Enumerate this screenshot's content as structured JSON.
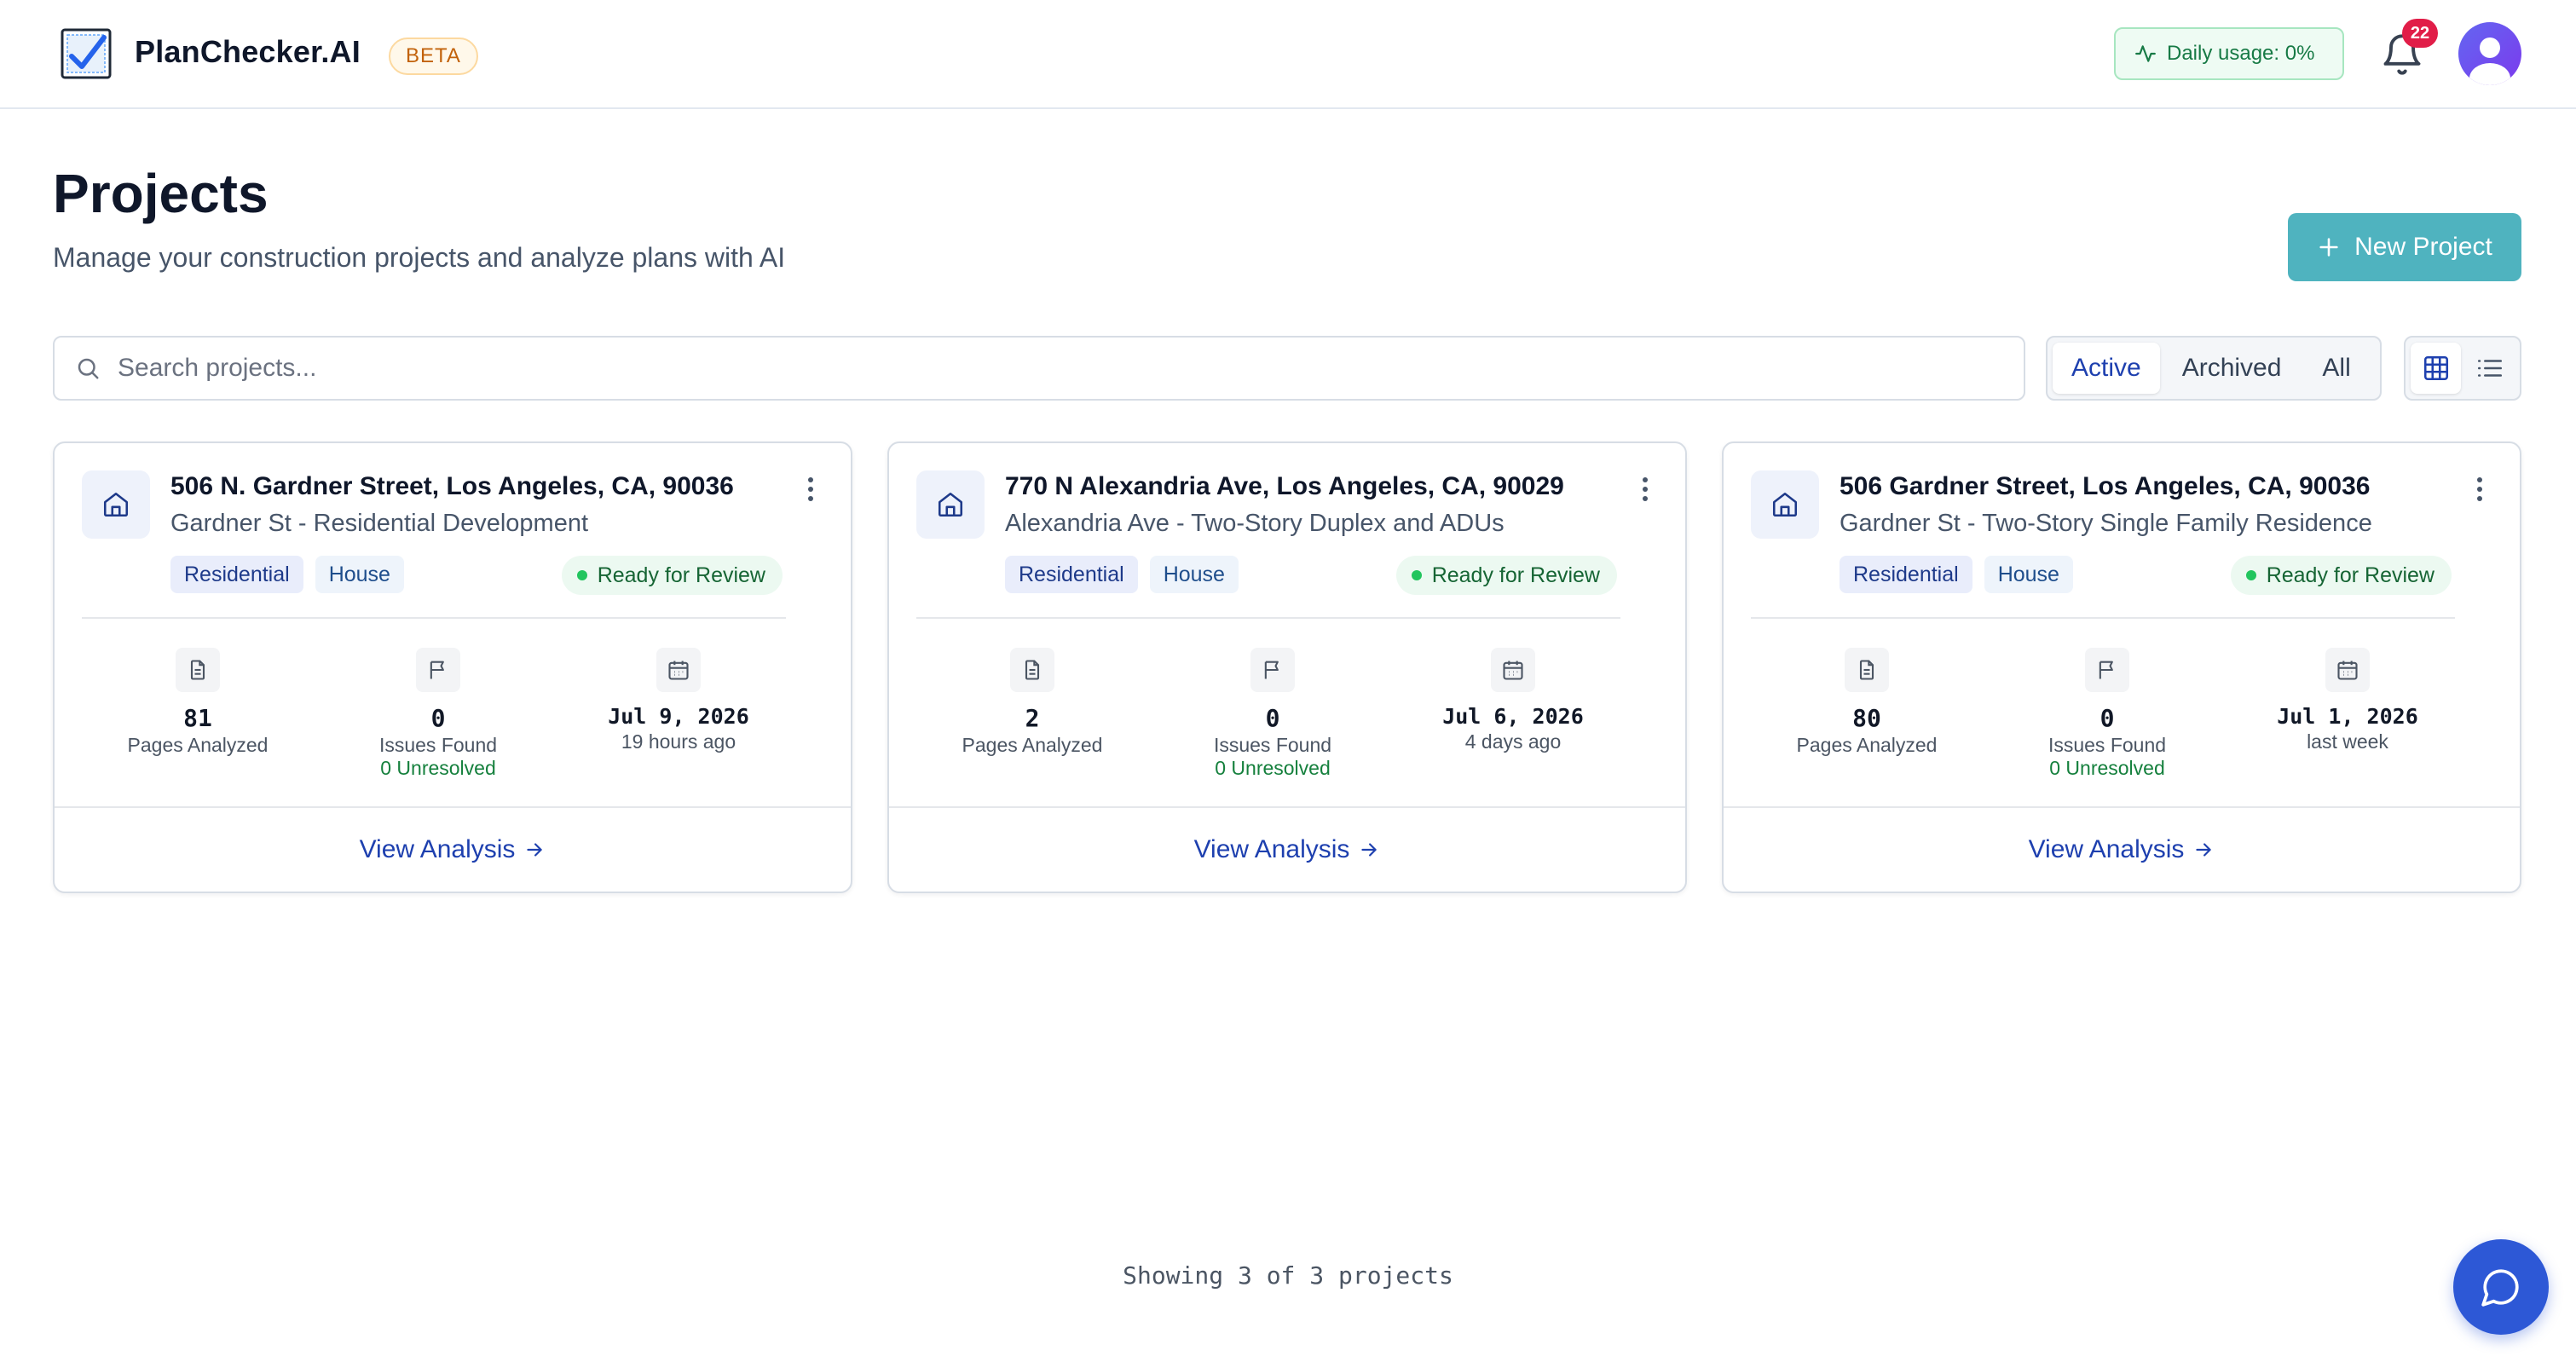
{
  "header": {
    "brand": "PlanChecker.AI",
    "badge": "BETA",
    "usage_label": "Daily usage: 0%",
    "notification_count": "22",
    "icons": [
      "logo-checklist-icon",
      "activity-icon",
      "bell-icon",
      "avatar-user-icon"
    ]
  },
  "page": {
    "title": "Projects",
    "subtitle": "Manage your construction projects and analyze plans with AI",
    "new_project_label": "New Project"
  },
  "search": {
    "placeholder": "Search projects..."
  },
  "filters": {
    "options": [
      "Active",
      "Archived",
      "All"
    ],
    "selected": "Active"
  },
  "view": {
    "selected": "grid",
    "icons": [
      "grid-view-icon",
      "list-view-icon"
    ]
  },
  "projects": [
    {
      "address": "506 N. Gardner Street, Los Angeles, CA, 90036",
      "name": "Gardner St - Residential Development",
      "tags": [
        "Residential",
        "House"
      ],
      "status": "Ready for Review",
      "pages": "81",
      "pages_label": "Pages Analyzed",
      "issues": "0",
      "issues_label": "Issues Found",
      "unresolved": "0 Unresolved",
      "date": "Jul 9, 2026",
      "relative": "19 hours ago",
      "action": "View Analysis"
    },
    {
      "address": "770 N Alexandria Ave, Los Angeles, CA, 90029",
      "name": "Alexandria Ave - Two-Story Duplex and ADUs",
      "tags": [
        "Residential",
        "House"
      ],
      "status": "Ready for Review",
      "pages": "2",
      "pages_label": "Pages Analyzed",
      "issues": "0",
      "issues_label": "Issues Found",
      "unresolved": "0 Unresolved",
      "date": "Jul 6, 2026",
      "relative": "4 days ago",
      "action": "View Analysis"
    },
    {
      "address": "506 Gardner Street, Los Angeles, CA, 90036",
      "name": "Gardner St - Two-Story Single Family Residence",
      "tags": [
        "Residential",
        "House"
      ],
      "status": "Ready for Review",
      "pages": "80",
      "pages_label": "Pages Analyzed",
      "issues": "0",
      "issues_label": "Issues Found",
      "unresolved": "0 Unresolved",
      "date": "Jul 1, 2026",
      "relative": "last week",
      "action": "View Analysis"
    }
  ],
  "footer": {
    "showing": "Showing 3 of 3 projects"
  },
  "colors": {
    "accent": "#4fb3bf",
    "link": "#1e40af",
    "status_green": "#22c55e",
    "chat": "#2d58d6"
  }
}
